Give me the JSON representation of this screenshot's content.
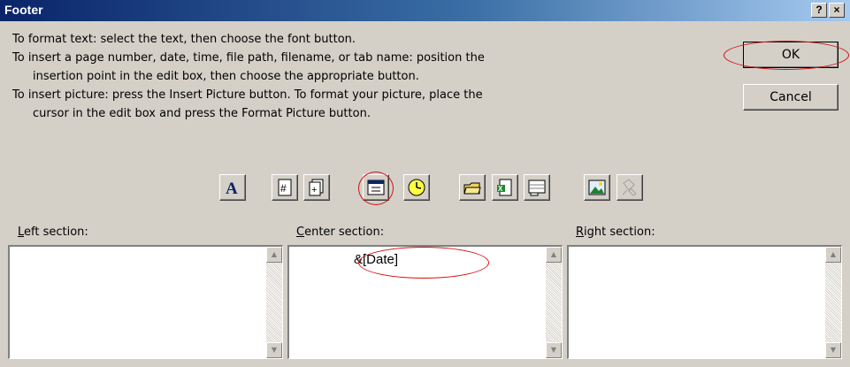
{
  "dialog": {
    "title": "Footer",
    "help_label": "?",
    "close_label": "×"
  },
  "instructions": [
    "To format text:  select the text, then choose the font button.",
    "To insert a page number, date, time, file path, filename, or tab name:  position the",
    "insertion point in the edit box, then choose the appropriate button.",
    "To insert picture: press the Insert Picture button.  To format your picture, place the",
    "cursor in the edit box and press the Format Picture button."
  ],
  "buttons": {
    "ok": "OK",
    "cancel": "Cancel"
  },
  "toolbar": {
    "icons": [
      "font-icon",
      "page-number-icon",
      "number-of-pages-icon",
      "date-icon",
      "time-icon",
      "file-path-icon",
      "filename-icon",
      "sheet-name-icon",
      "insert-picture-icon",
      "format-picture-icon"
    ]
  },
  "sections": {
    "left": {
      "label": "Left section:",
      "accesskey": "L",
      "rest": "eft section:",
      "value": ""
    },
    "center": {
      "label": "Center section:",
      "accesskey": "C",
      "rest": "enter section:",
      "value": "&[Date]"
    },
    "right": {
      "label": "Right section:",
      "accesskey": "R",
      "rest": "ight section:",
      "value": ""
    }
  },
  "highlight_color": "#d21010"
}
